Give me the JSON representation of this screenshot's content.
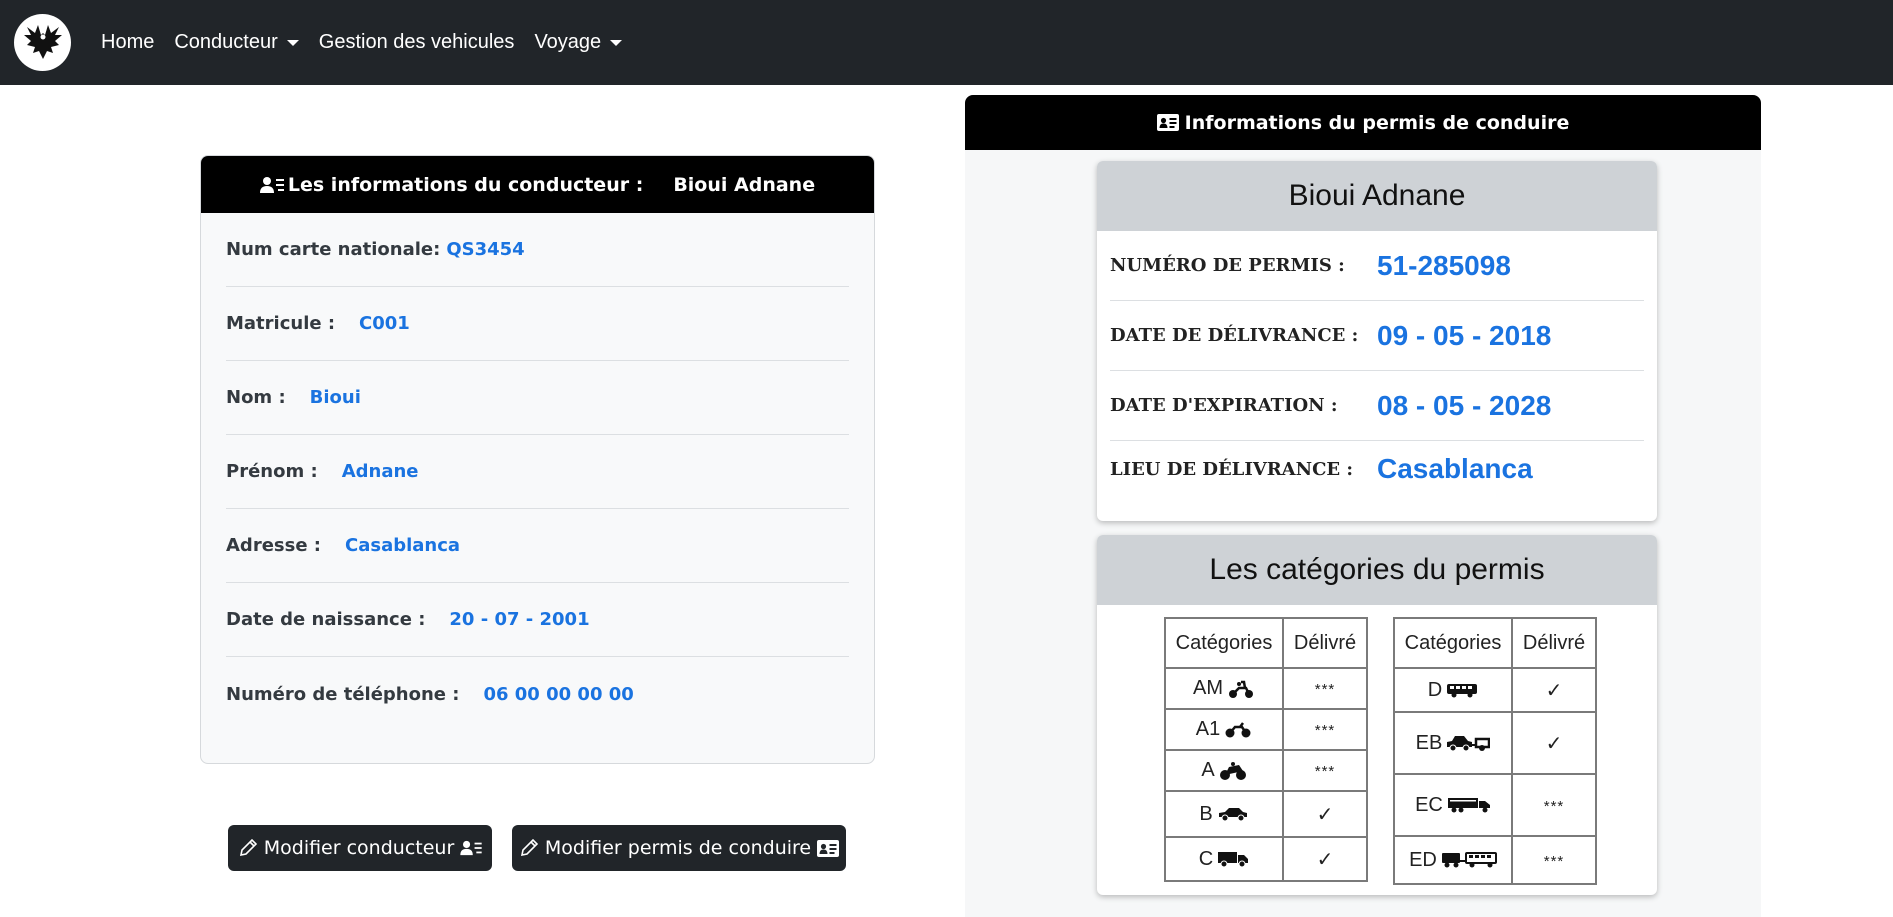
{
  "nav": {
    "items": [
      {
        "label": "Home",
        "dropdown": false
      },
      {
        "label": "Conducteur",
        "dropdown": true
      },
      {
        "label": "Gestion des vehicules",
        "dropdown": false
      },
      {
        "label": "Voyage",
        "dropdown": true
      }
    ]
  },
  "driver": {
    "header_label": "Les informations du conducteur :",
    "header_name": "Bioui Adnane",
    "rows": [
      {
        "label": "Num carte nationale:",
        "value": "QS3454"
      },
      {
        "label": "Matricule :",
        "value": "C001"
      },
      {
        "label": "Nom :",
        "value": "Bioui"
      },
      {
        "label": "Prénom :",
        "value": "Adnane"
      },
      {
        "label": "Adresse :",
        "value": "Casablanca"
      },
      {
        "label": "Date de naissance :",
        "value": "20 - 07 - 2001"
      },
      {
        "label": "Numéro de téléphone :",
        "value": "06 00 00 00 00"
      }
    ]
  },
  "buttons": {
    "edit_driver": "Modifier conducteur",
    "edit_license": "Modifier permis de conduire"
  },
  "license": {
    "header": "Informations du permis de conduire",
    "holder_name": "Bioui Adnane",
    "rows": [
      {
        "label": "NUMÉRO DE PERMIS :",
        "value": "51-285098"
      },
      {
        "label": "DATE DE DÉLIVRANCE :",
        "value": "09 - 05 - 2018"
      },
      {
        "label": "DATE D'EXPIRATION :",
        "value": "08 - 05 - 2028"
      },
      {
        "label": "LIEU DE DÉLIVRANCE :",
        "value": "Casablanca"
      }
    ],
    "categories_title": "Les catégories du permis",
    "col_category": "Catégories",
    "col_delivered": "Délivré",
    "left_table": [
      {
        "cat": "AM",
        "icon": "scooter-icon",
        "delivered": "***"
      },
      {
        "cat": "A1",
        "icon": "motorcycle-icon",
        "delivered": "***"
      },
      {
        "cat": "A",
        "icon": "sport-motorcycle-icon",
        "delivered": "***"
      },
      {
        "cat": "B",
        "icon": "car-icon",
        "delivered": "✓"
      },
      {
        "cat": "C",
        "icon": "truck-icon",
        "delivered": "✓"
      }
    ],
    "right_table": [
      {
        "cat": "D",
        "icon": "bus-icon",
        "delivered": "✓"
      },
      {
        "cat": "EB",
        "icon": "car-trailer-icon",
        "delivered": "✓"
      },
      {
        "cat": "EC",
        "icon": "semi-truck-icon",
        "delivered": "***"
      },
      {
        "cat": "ED",
        "icon": "bus-trailer-icon",
        "delivered": "***"
      }
    ]
  }
}
